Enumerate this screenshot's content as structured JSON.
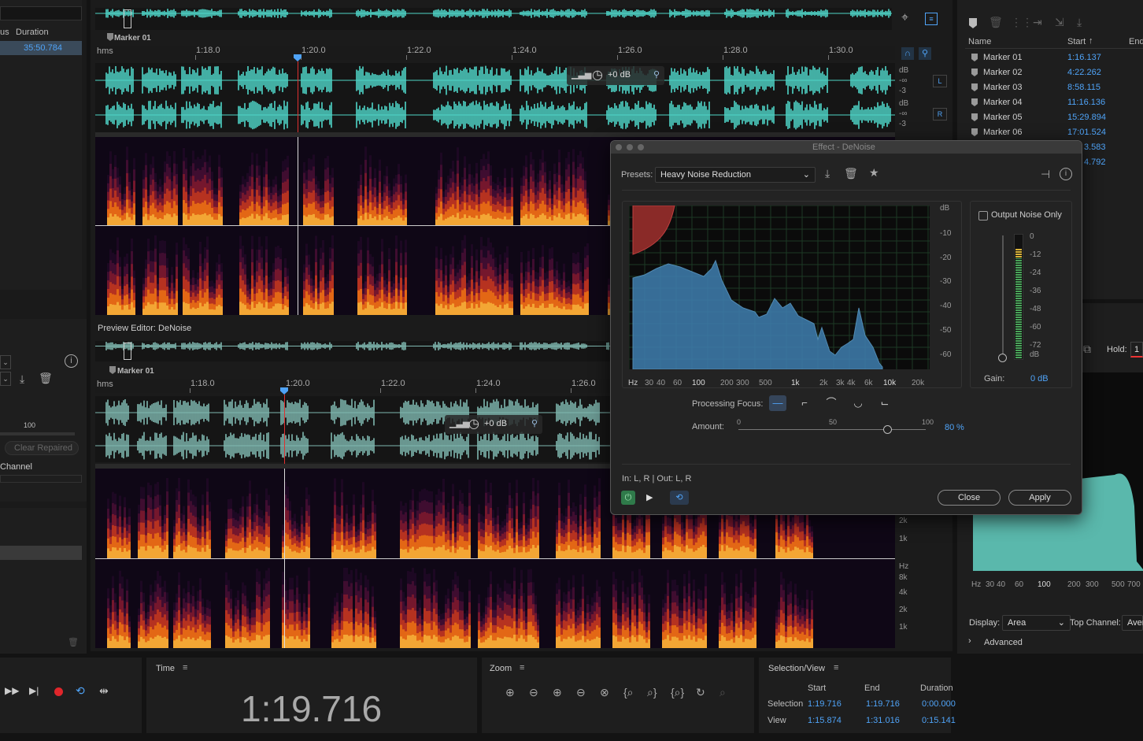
{
  "left_panel": {
    "col_us": "us",
    "col_duration": "Duration",
    "duration_value": "35:50.784",
    "value_100": "100",
    "clear_repaired": "Clear Repaired",
    "channel_label": "Channel"
  },
  "main_editor": {
    "marker_label": "Marker 01",
    "ruler_unit": "hms",
    "ruler_ticks": [
      "1:18.0",
      "1:20.0",
      "1:22.0",
      "1:24.0",
      "1:26.0",
      "1:28.0",
      "1:30.0"
    ],
    "hud_gain": "+0 dB",
    "db_label": "dB",
    "db_inf": "-∞",
    "db_minus3": "-3",
    "channel_L": "L",
    "channel_R": "R"
  },
  "preview_editor": {
    "title": "Preview Editor: DeNoise",
    "marker_label": "Marker 01",
    "ruler_unit": "hms",
    "ruler_ticks": [
      "1:18.0",
      "1:20.0",
      "1:22.0",
      "1:24.0",
      "1:26.0"
    ],
    "hud_gain": "+0 dB",
    "freq_labels_top": [
      "2k",
      "1k"
    ],
    "freq_labels_bottom": [
      "Hz",
      "8k",
      "4k",
      "2k",
      "1k"
    ]
  },
  "markers_panel": {
    "col_name": "Name",
    "col_start": "Start",
    "col_end": "End",
    "rows": [
      {
        "name": "Marker 01",
        "start": "1:16.137"
      },
      {
        "name": "Marker 02",
        "start": "4:22.262"
      },
      {
        "name": "Marker 03",
        "start": "8:58.115"
      },
      {
        "name": "Marker 04",
        "start": "11:16.136"
      },
      {
        "name": "Marker 05",
        "start": "15:29.894"
      },
      {
        "name": "Marker 06",
        "start": "17:01.524"
      }
    ],
    "row7_start": "3.583",
    "row8_start": "4.792"
  },
  "right_panel": {
    "hold_label": "Hold:",
    "hold_value": "1",
    "x_labels": [
      "Hz",
      "30",
      "40",
      "60",
      "100",
      "200",
      "300",
      "500",
      "700"
    ],
    "display_label": "Display:",
    "display_value": "Area",
    "top_channel_label": "Top Channel:",
    "top_channel_value": "Aver",
    "advanced_label": "Advanced"
  },
  "dialog": {
    "title": "Effect - DeNoise",
    "presets_label": "Presets:",
    "preset_value": "Heavy Noise Reduction",
    "output_noise_only": "Output Noise Only",
    "db_axis": [
      "dB",
      "-10",
      "-20",
      "-30",
      "-40",
      "-50",
      "-60"
    ],
    "freq_axis": [
      "Hz",
      "30",
      "40",
      "60",
      "100",
      "200",
      "300",
      "500",
      "1k",
      "2k",
      "3k",
      "4k",
      "6k",
      "10k",
      "20k"
    ],
    "meter_scale": [
      "0",
      "-12",
      "-24",
      "-36",
      "-48",
      "-60",
      "-72",
      "dB"
    ],
    "gain_label": "Gain:",
    "gain_value": "0 dB",
    "processing_focus_label": "Processing Focus:",
    "amount_label": "Amount:",
    "amount_scale": [
      "0",
      "50",
      "100"
    ],
    "amount_value": "80",
    "amount_unit": "%",
    "io_label": "In: L, R | Out: L, R",
    "close_label": "Close",
    "apply_label": "Apply",
    "colors": {
      "spectrum": "#3f7fb0",
      "noise_threshold": "#8a2a28",
      "accent": "#4fa3f7"
    }
  },
  "time_panel": {
    "title": "Time",
    "value": "1:19.716"
  },
  "zoom_panel": {
    "title": "Zoom"
  },
  "selection_panel": {
    "title": "Selection/View",
    "col_start": "Start",
    "col_end": "End",
    "col_duration": "Duration",
    "selection_label": "Selection",
    "selection_start": "1:19.716",
    "selection_end": "1:19.716",
    "selection_duration": "0:00.000",
    "view_label": "View",
    "view_start": "1:15.874",
    "view_end": "1:31.016",
    "view_duration": "0:15.141"
  }
}
